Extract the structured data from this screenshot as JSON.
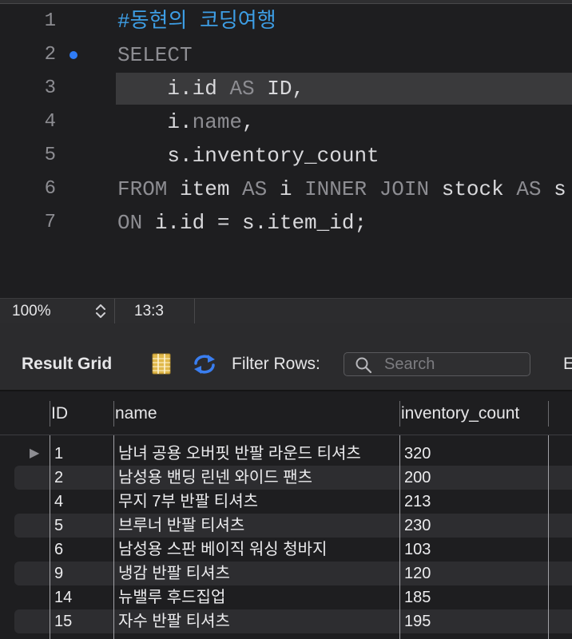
{
  "editor": {
    "current_line": 3,
    "breakpoint_line": 2,
    "lines": [
      {
        "number": "1",
        "tokens": [
          {
            "type": "comment",
            "text": "#동현의 코딩여행"
          }
        ]
      },
      {
        "number": "2",
        "tokens": [
          {
            "type": "keyword",
            "text": "SELECT"
          }
        ]
      },
      {
        "number": "3",
        "tokens": [
          {
            "type": "ident",
            "text": "    i.id "
          },
          {
            "type": "keyword",
            "text": "AS"
          },
          {
            "type": "ident",
            "text": " ID,"
          }
        ]
      },
      {
        "number": "4",
        "tokens": [
          {
            "type": "ident",
            "text": "    i."
          },
          {
            "type": "keyword",
            "text": "name"
          },
          {
            "type": "ident",
            "text": ","
          }
        ]
      },
      {
        "number": "5",
        "tokens": [
          {
            "type": "ident",
            "text": "    s.inventory_count"
          }
        ]
      },
      {
        "number": "6",
        "tokens": [
          {
            "type": "keyword",
            "text": "FROM"
          },
          {
            "type": "ident",
            "text": " item "
          },
          {
            "type": "keyword",
            "text": "AS"
          },
          {
            "type": "ident",
            "text": " i "
          },
          {
            "type": "keyword",
            "text": "INNER JOIN"
          },
          {
            "type": "ident",
            "text": " stock "
          },
          {
            "type": "keyword",
            "text": "AS"
          },
          {
            "type": "ident",
            "text": " s"
          }
        ]
      },
      {
        "number": "7",
        "tokens": [
          {
            "type": "keyword",
            "text": "ON"
          },
          {
            "type": "ident",
            "text": " i.id = s.item_id;"
          }
        ]
      }
    ]
  },
  "status": {
    "zoom": "100%",
    "cursor": "13:3"
  },
  "toolbar": {
    "result_grid_label": "Result Grid",
    "filter_label": "Filter Rows:",
    "search_placeholder": "Search",
    "search_value": "",
    "cut_label": "E"
  },
  "table": {
    "columns": [
      "ID",
      "name",
      "inventory_count"
    ],
    "selected_row": 0,
    "rows": [
      [
        "1",
        "남녀 공용 오버핏 반팔 라운드 티셔츠",
        "320"
      ],
      [
        "2",
        "남성용 밴딩 린넨 와이드 팬츠",
        "200"
      ],
      [
        "4",
        "무지 7부 반팔 티셔츠",
        "213"
      ],
      [
        "5",
        "브루너 반팔 티셔츠",
        "230"
      ],
      [
        "6",
        "남성용 스판 베이직 워싱 청바지",
        "103"
      ],
      [
        "9",
        "냉감 반팔 티셔츠",
        "120"
      ],
      [
        "14",
        "뉴밸루 후드집업",
        "185"
      ],
      [
        "15",
        "자수 반팔 티셔츠",
        "195"
      ]
    ]
  },
  "colors": {
    "comment": "#3d9ee5",
    "keyword": "#8d8d92",
    "identifier": "#d9d9dc",
    "current_line_bg": "#3a3a3c",
    "breakpoint": "#2f7cf6",
    "grid_icon": "#e0b84a",
    "refresh_icon": "#3a7ef0"
  },
  "icons": {
    "breakpoint": "breakpoint-icon",
    "zoom_stepper": "stepper-icon",
    "result_grid": "grid-icon",
    "refresh": "refresh-icon",
    "search": "search-icon",
    "row_pointer": "row-pointer-icon"
  }
}
